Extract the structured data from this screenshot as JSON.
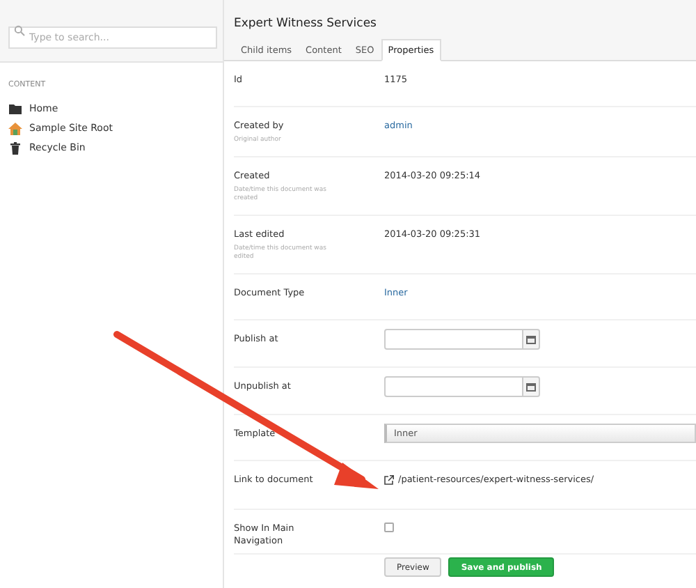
{
  "search": {
    "placeholder": "Type to search..."
  },
  "sidebar": {
    "section": "CONTENT",
    "items": [
      {
        "label": "Home",
        "kind": "folder"
      },
      {
        "label": "Sample Site Root",
        "kind": "house"
      },
      {
        "label": "Recycle Bin",
        "kind": "trash"
      }
    ]
  },
  "document": {
    "title": "Expert Witness Services"
  },
  "tabs": [
    {
      "label": "Child items",
      "selected": false
    },
    {
      "label": "Content",
      "selected": false
    },
    {
      "label": "SEO",
      "selected": false
    },
    {
      "label": "Properties",
      "selected": true
    }
  ],
  "properties": [
    {
      "kind": "text",
      "label": "Id",
      "value": "1175"
    },
    {
      "kind": "link",
      "label": "Created by",
      "description": "Original author",
      "value": "admin"
    },
    {
      "kind": "text",
      "label": "Created",
      "description": "Date/time this document was created",
      "value": "2014-03-20 09:25:14"
    },
    {
      "kind": "text",
      "label": "Last edited",
      "description": "Date/time this document was edited",
      "value": "2014-03-20 09:25:31"
    },
    {
      "kind": "link",
      "label": "Document Type",
      "value": "Inner"
    },
    {
      "kind": "date",
      "label": "Publish at"
    },
    {
      "kind": "date",
      "label": "Unpublish at"
    },
    {
      "kind": "select",
      "label": "Template",
      "value": "Inner"
    },
    {
      "kind": "url",
      "label": "Link to document",
      "value": "/patient-resources/expert-witness-services/"
    },
    {
      "kind": "checkbox",
      "label": "Show In Main Navigation",
      "checked": false
    }
  ],
  "buttons": [
    {
      "label": "Preview",
      "kind": "secondary"
    },
    {
      "label": "Save and publish",
      "kind": "primary"
    }
  ]
}
